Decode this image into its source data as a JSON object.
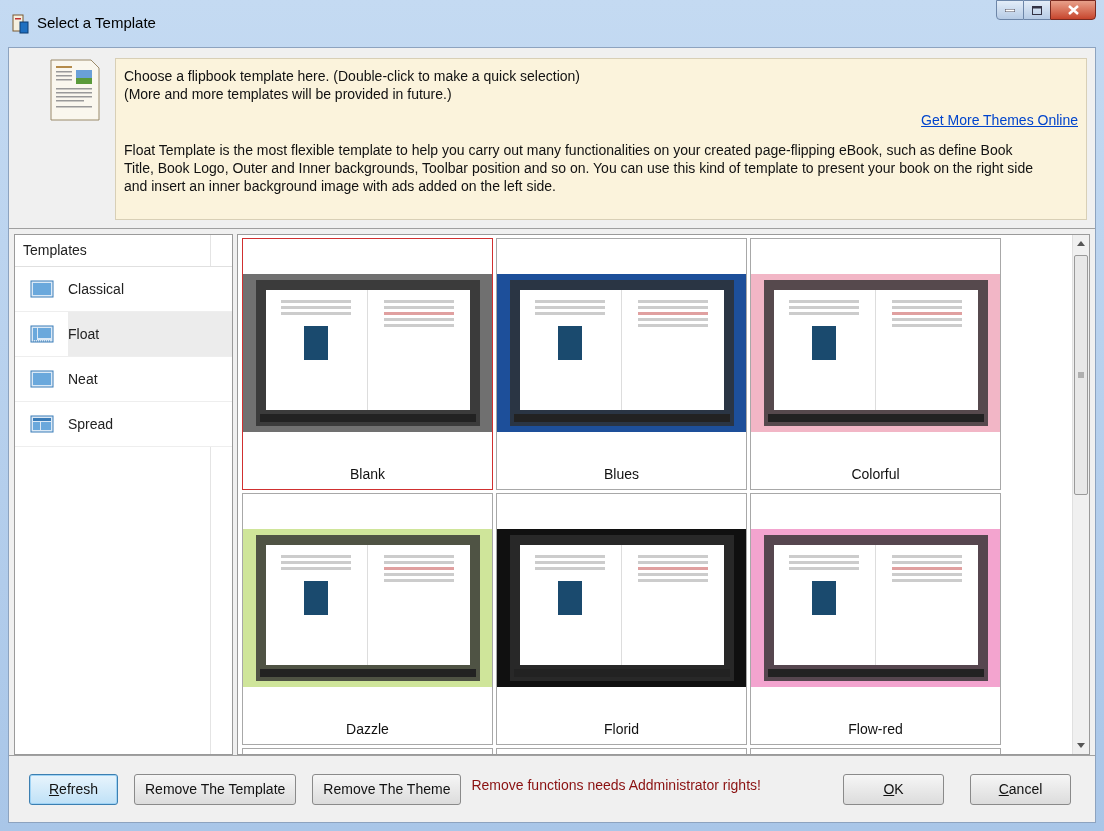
{
  "window": {
    "title": "Select a Template"
  },
  "info": {
    "lines": [
      "Choose a flipbook template here. (Double-click to make a quick selection)",
      "(More and more templates will be provided in future.)"
    ],
    "link": "Get More Themes Online",
    "description": "Float Template is the most flexible template to help you carry out many functionalities on your created page-flipping eBook, such as define Book Title, Book Logo, Outer and Inner backgrounds, Toolbar position and so on. You can use this kind of template to present your book on the right side and insert an inner background image with ads added on the left side."
  },
  "sidebar": {
    "header": "Templates",
    "items": [
      {
        "label": "Classical",
        "kind": "full",
        "selected": false
      },
      {
        "label": "Float",
        "kind": "float",
        "selected": true
      },
      {
        "label": "Neat",
        "kind": "full",
        "selected": false
      },
      {
        "label": "Spread",
        "kind": "split",
        "selected": false
      }
    ]
  },
  "templates": [
    {
      "label": "Blank",
      "color": "#707070",
      "selected": true
    },
    {
      "label": "Blues",
      "color": "#1d4f9a",
      "selected": false
    },
    {
      "label": "Colorful",
      "color": "#f2b6c6",
      "selected": false
    },
    {
      "label": "Dazzle",
      "color": "#cfe59a",
      "selected": false
    },
    {
      "label": "Florid",
      "color": "#101010",
      "selected": false
    },
    {
      "label": "Flow-red",
      "color": "#f3a4cf",
      "selected": false
    }
  ],
  "buttons": [
    {
      "label": "Refresh",
      "access_key": true,
      "focused": true
    },
    {
      "label": "Remove The Template",
      "access_key": false,
      "focused": false
    },
    {
      "label": "Remove The Theme",
      "access_key": false,
      "focused": false
    }
  ],
  "warning": "Remove functions needs Addministrator rights!",
  "dialog_buttons": [
    {
      "label": "OK",
      "access_key": true,
      "focused": false
    },
    {
      "label": "Cancel",
      "access_key": true,
      "focused": false
    }
  ]
}
